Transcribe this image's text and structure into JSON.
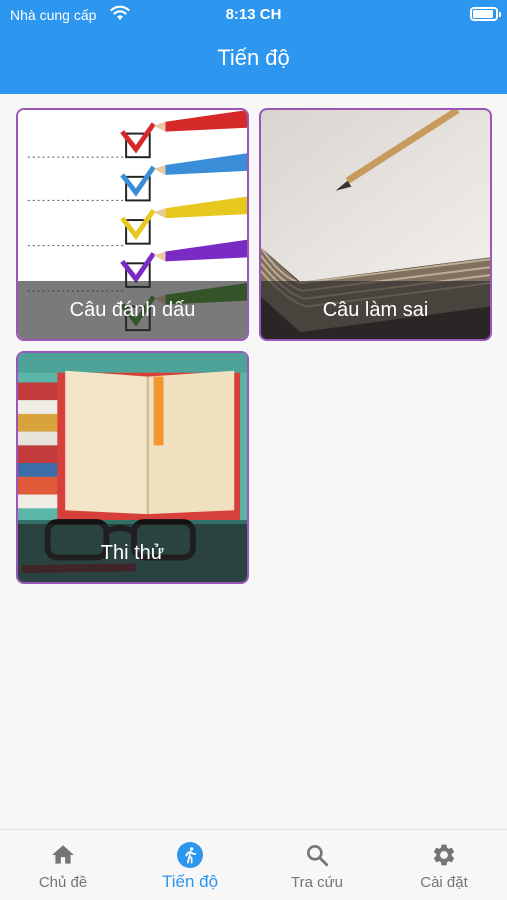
{
  "status_bar": {
    "carrier": "Nhà cung cấp",
    "time": "8:13 CH"
  },
  "header": {
    "title": "Tiến độ"
  },
  "tiles": [
    {
      "label": "Câu đánh dấu"
    },
    {
      "label": "Câu làm sai"
    },
    {
      "label": "Thi thử"
    }
  ],
  "tabs": [
    {
      "label": "Chủ đề",
      "icon": "home-icon"
    },
    {
      "label": "Tiến độ",
      "icon": "runner-icon",
      "active": true
    },
    {
      "label": "Tra cứu",
      "icon": "search-icon"
    },
    {
      "label": "Cài đặt",
      "icon": "gear-icon"
    }
  ],
  "colors": {
    "accent": "#2d96ee",
    "tile_border": "#9b57b8",
    "inactive_tab": "#757575"
  }
}
